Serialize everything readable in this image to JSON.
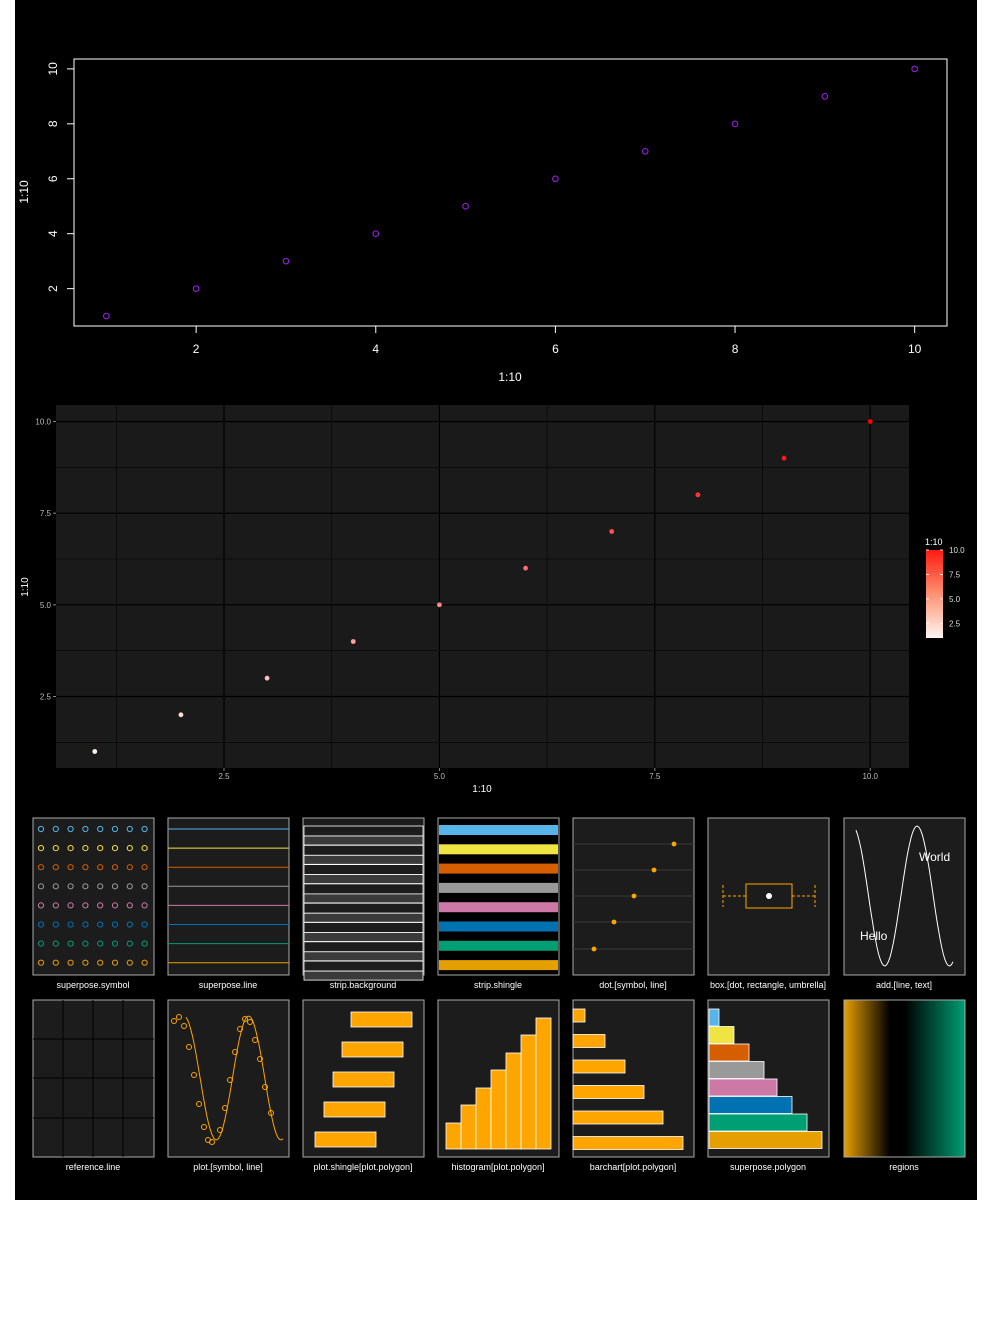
{
  "colors": {
    "background": "#000000",
    "base_point": "#a020f0",
    "axis": "#ffffff",
    "ggplot_panel": "#1a1a1a",
    "ggplot_grid": "#000000",
    "lattice_panel": "#1c1c1c",
    "gradient_low": "#fff5f0",
    "gradient_high": "#ff0000",
    "orange": "#ffa500",
    "orange_dark": "#e69f00"
  },
  "chart_data": [
    {
      "type": "scatter",
      "x": [
        1,
        2,
        3,
        4,
        5,
        6,
        7,
        8,
        9,
        10
      ],
      "y": [
        1,
        2,
        3,
        4,
        5,
        6,
        7,
        8,
        9,
        10
      ],
      "xlabel": "1:10",
      "ylabel": "1:10",
      "xticks": [
        2,
        4,
        6,
        8,
        10
      ],
      "yticks": [
        2,
        4,
        6,
        8,
        10
      ],
      "xlim": [
        0.64,
        10.36
      ],
      "ylim": [
        0.64,
        10.36
      ],
      "grid": false
    },
    {
      "type": "scatter",
      "x": [
        1,
        2,
        3,
        4,
        5,
        6,
        7,
        8,
        9,
        10
      ],
      "y": [
        1,
        2,
        3,
        4,
        5,
        6,
        7,
        8,
        9,
        10
      ],
      "color_values": [
        1,
        2,
        3,
        4,
        5,
        6,
        7,
        8,
        9,
        10
      ],
      "xlabel": "1:10",
      "ylabel": "1:10",
      "xticks": [
        "2.5",
        "5.0",
        "7.5",
        "10.0"
      ],
      "yticks": [
        "2.5",
        "5.0",
        "7.5",
        "10.0"
      ],
      "xlim": [
        0.55,
        10.45
      ],
      "ylim": [
        0.55,
        10.45
      ],
      "grid": true,
      "legend": {
        "title": "1:10",
        "labels": [
          "10.0",
          "7.5",
          "5.0",
          "2.5"
        ],
        "placement": "right"
      }
    }
  ],
  "panels": {
    "row1": [
      {
        "label": "superpose.symbol"
      },
      {
        "label": "superpose.line"
      },
      {
        "label": "strip.background"
      },
      {
        "label": "strip.shingle"
      },
      {
        "label": "dot.[symbol, line]"
      },
      {
        "label": "box.[dot, rectangle, umbrella]"
      },
      {
        "label": "add.[line, text]",
        "text1": "World",
        "text2": "Hello"
      }
    ],
    "row2": [
      {
        "label": "reference.line"
      },
      {
        "label": "plot.[symbol, line]"
      },
      {
        "label": "plot.shingle[plot.polygon]"
      },
      {
        "label": "histogram[plot.polygon]"
      },
      {
        "label": "barchart[plot.polygon]"
      },
      {
        "label": "superpose.polygon"
      },
      {
        "label": "regions"
      }
    ]
  },
  "palette": [
    "#56b4e9",
    "#f0e442",
    "#d55e00",
    "#999999",
    "#cc79a7",
    "#0072b2",
    "#009e73",
    "#e69f00"
  ]
}
